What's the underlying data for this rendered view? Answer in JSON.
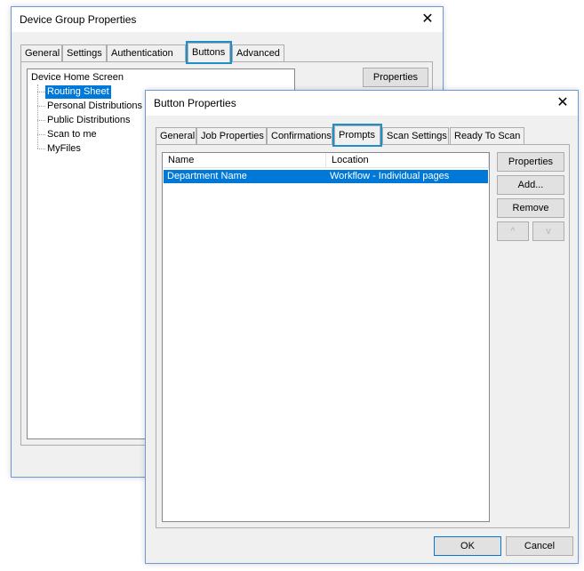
{
  "device_dialog": {
    "title": "Device Group Properties",
    "close_glyph": "✕",
    "tabs": [
      "General",
      "Settings",
      "Authentication",
      "Buttons",
      "Advanced"
    ],
    "active_tab": "Buttons",
    "properties_label": "Properties",
    "tree": {
      "root": "Device Home Screen",
      "items": [
        "Routing Sheet",
        "Personal Distributions",
        "Public Distributions",
        "Scan to me",
        "MyFiles"
      ],
      "selected": "Routing Sheet"
    }
  },
  "button_dialog": {
    "title": "Button Properties",
    "close_glyph": "✕",
    "tabs": [
      "General",
      "Job Properties",
      "Confirmations",
      "Prompts",
      "Scan Settings",
      "Ready To Scan"
    ],
    "active_tab": "Prompts",
    "list": {
      "columns": [
        "Name",
        "Location"
      ],
      "rows": [
        {
          "name": "Department Name",
          "location": "Workflow - Individual pages"
        }
      ],
      "selected_row": 0
    },
    "buttons": {
      "properties": "Properties",
      "add": "Add...",
      "remove": "Remove",
      "up": "^",
      "down": "v",
      "ok": "OK",
      "cancel": "Cancel"
    }
  },
  "colors": {
    "accent_highlight": "#1e8fc8",
    "selection": "#0078d7",
    "window_border": "#6d9ad3"
  }
}
